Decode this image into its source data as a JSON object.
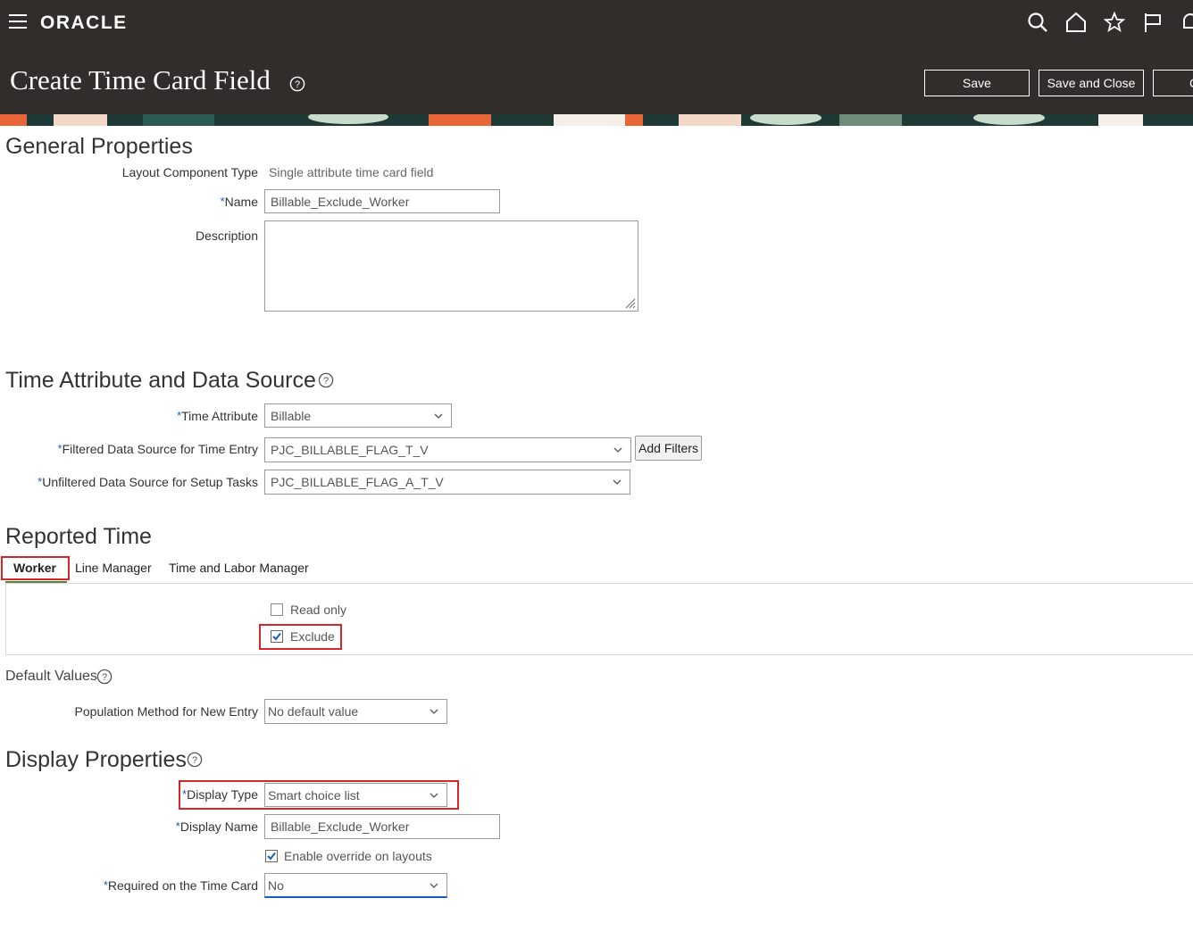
{
  "header": {
    "logo": "ORACLE",
    "page_title": "Create Time Card Field",
    "save_label": "Save",
    "save_close_label": "Save and Close",
    "cancel_label": "C"
  },
  "icons": {
    "menu": "hamburger-menu-icon",
    "search": "search-icon",
    "home": "home-icon",
    "favorites": "star-icon",
    "flag": "flag-icon",
    "notifications": "bell-icon",
    "help": "help-circle-icon"
  },
  "general": {
    "heading": "General Properties",
    "layout_type_label": "Layout Component Type",
    "layout_type_value": "Single attribute time card field",
    "name_label": "Name",
    "name_value": "Billable_Exclude_Worker",
    "description_label": "Description",
    "description_value": ""
  },
  "time_attribute": {
    "heading": "Time Attribute and Data Source",
    "time_attribute_label": "Time Attribute",
    "time_attribute_value": "Billable",
    "filtered_label": "Filtered Data Source for Time Entry",
    "filtered_value": "PJC_BILLABLE_FLAG_T_V",
    "add_filters_label": "Add Filters",
    "unfiltered_label": "Unfiltered Data Source for Setup Tasks",
    "unfiltered_value": "PJC_BILLABLE_FLAG_A_T_V"
  },
  "reported_time": {
    "heading": "Reported Time",
    "tabs": [
      "Worker",
      "Line Manager",
      "Time and Labor Manager"
    ],
    "selected_tab": "Worker",
    "read_only_label": "Read only",
    "read_only_checked": false,
    "exclude_label": "Exclude",
    "exclude_checked": true
  },
  "default_values": {
    "heading": "Default Values",
    "population_label": "Population Method for New Entry",
    "population_value": "No default value"
  },
  "display": {
    "heading": "Display Properties",
    "display_type_label": "Display Type",
    "display_type_value": "Smart choice list",
    "display_name_label": "Display Name",
    "display_name_value": "Billable_Exclude_Worker",
    "enable_override_label": "Enable override on layouts",
    "enable_override_checked": true,
    "required_label": "Required on the Time Card",
    "required_value": "No"
  },
  "colors": {
    "header_bg": "#312d2a",
    "highlight": "#d62728",
    "required_mark": "#1a5fb4",
    "tab_underline": "#6b7d3c"
  }
}
